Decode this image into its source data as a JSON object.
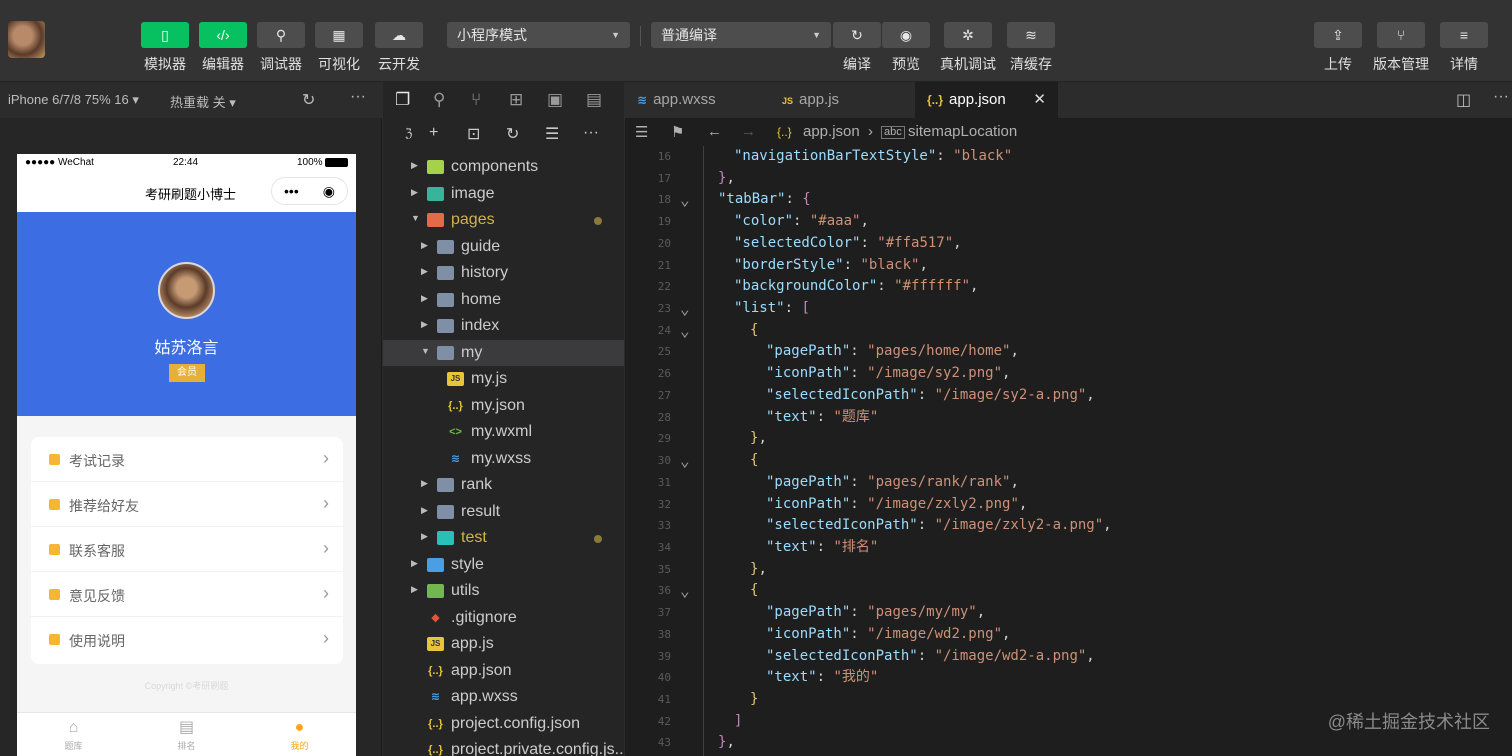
{
  "toolbar": {
    "left_buttons": [
      {
        "label": "模拟器",
        "icon": "phone-icon",
        "glyph": "▯",
        "green": true
      },
      {
        "label": "编辑器",
        "icon": "code-icon",
        "glyph": "‹/›",
        "green": true
      },
      {
        "label": "调试器",
        "icon": "debug-icon",
        "glyph": "⚲",
        "green": false
      },
      {
        "label": "可视化",
        "icon": "layout-icon",
        "glyph": "▦",
        "green": false
      },
      {
        "label": "云开发",
        "icon": "cloud-icon",
        "glyph": "☁",
        "green": false
      }
    ],
    "mode_select": "小程序模式",
    "compile_select": "普通编译",
    "mid_buttons": [
      {
        "label": "编译",
        "icon": "refresh-icon",
        "glyph": "↻"
      },
      {
        "label": "预览",
        "icon": "eye-icon",
        "glyph": "◉"
      },
      {
        "label": "真机调试",
        "icon": "bug-icon",
        "glyph": "✲"
      },
      {
        "label": "清缓存",
        "icon": "layers-icon",
        "glyph": "≋"
      }
    ],
    "right_buttons": [
      {
        "label": "上传",
        "icon": "upload-icon",
        "glyph": "⇪"
      },
      {
        "label": "版本管理",
        "icon": "branch-icon",
        "glyph": "⑂"
      },
      {
        "label": "详情",
        "icon": "menu-icon",
        "glyph": "≡"
      }
    ]
  },
  "simulator": {
    "device": "iPhone 6/7/8 75% 16 ▾",
    "reload": "热重载 关 ▾",
    "status_left": "●●●●● WeChat",
    "status_time": "22:44",
    "status_right": "100%",
    "nav_title": "考研刷题小博士",
    "user_name": "姑苏洛言",
    "member_badge": "会员",
    "menu": [
      "考试记录",
      "推荐给好友",
      "联系客服",
      "意见反馈",
      "使用说明"
    ],
    "faint_text": "Copyright ©考研刷题",
    "tabs": [
      {
        "label": "题库",
        "icon": "home-icon",
        "glyph": "⌂",
        "active": false
      },
      {
        "label": "排名",
        "icon": "list-icon",
        "glyph": "▤",
        "active": false
      },
      {
        "label": "我的",
        "icon": "user-icon",
        "glyph": "●",
        "active": true
      }
    ]
  },
  "explorer": {
    "items": [
      {
        "name": "components",
        "depth": 0,
        "type": "folder",
        "open": false,
        "color": "#a6d14a"
      },
      {
        "name": "image",
        "depth": 0,
        "type": "folder",
        "open": false,
        "color": "#39b39a"
      },
      {
        "name": "pages",
        "depth": 0,
        "type": "folder",
        "open": true,
        "color": "#e46b4a",
        "modified": true
      },
      {
        "name": "guide",
        "depth": 1,
        "type": "folder",
        "open": false,
        "color": "#7f8fa6"
      },
      {
        "name": "history",
        "depth": 1,
        "type": "folder",
        "open": false,
        "color": "#7f8fa6"
      },
      {
        "name": "home",
        "depth": 1,
        "type": "folder",
        "open": false,
        "color": "#7f8fa6"
      },
      {
        "name": "index",
        "depth": 1,
        "type": "folder",
        "open": false,
        "color": "#7f8fa6"
      },
      {
        "name": "my",
        "depth": 1,
        "type": "folder",
        "open": true,
        "color": "#7f8fa6",
        "selected": true
      },
      {
        "name": "my.js",
        "depth": 2,
        "type": "js"
      },
      {
        "name": "my.json",
        "depth": 2,
        "type": "json"
      },
      {
        "name": "my.wxml",
        "depth": 2,
        "type": "wxml"
      },
      {
        "name": "my.wxss",
        "depth": 2,
        "type": "wxss"
      },
      {
        "name": "rank",
        "depth": 1,
        "type": "folder",
        "open": false,
        "color": "#7f8fa6"
      },
      {
        "name": "result",
        "depth": 1,
        "type": "folder",
        "open": false,
        "color": "#7f8fa6"
      },
      {
        "name": "test",
        "depth": 1,
        "type": "folder",
        "open": false,
        "color": "#29c1b7",
        "modified": true,
        "yellow": true
      },
      {
        "name": "style",
        "depth": 0,
        "type": "folder",
        "open": false,
        "color": "#4a9ee4"
      },
      {
        "name": "utils",
        "depth": 0,
        "type": "folder",
        "open": false,
        "color": "#72b84e"
      },
      {
        "name": ".gitignore",
        "depth": 0,
        "type": "git"
      },
      {
        "name": "app.js",
        "depth": 0,
        "type": "js"
      },
      {
        "name": "app.json",
        "depth": 0,
        "type": "json"
      },
      {
        "name": "app.wxss",
        "depth": 0,
        "type": "wxss"
      },
      {
        "name": "project.config.json",
        "depth": 0,
        "type": "json"
      },
      {
        "name": "project.private.config.js...",
        "depth": 0,
        "type": "json"
      }
    ]
  },
  "editor": {
    "tabs": [
      {
        "label": "app.wxss",
        "icon": "css-icon",
        "glyph": "≋",
        "color": "#4a9ee4",
        "active": false
      },
      {
        "label": "app.js",
        "icon": "js-icon",
        "glyph": "JS",
        "color": "#e8c43a",
        "active": false
      },
      {
        "label": "app.json",
        "icon": "json-icon",
        "glyph": "{..}",
        "color": "#e8c43a",
        "active": true
      }
    ],
    "close_glyph": "✕",
    "breadcrumb": [
      "app.json",
      "sitemapLocation"
    ],
    "lines": [
      {
        "n": "16",
        "i": 1,
        "t": [
          [
            "k",
            "\"navigationBarTextStyle\""
          ],
          [
            "p",
            ": "
          ],
          [
            "s",
            "\"black\""
          ]
        ]
      },
      {
        "n": "17",
        "i": 0,
        "t": [
          [
            "b2",
            "}"
          ],
          [
            "p",
            ","
          ]
        ]
      },
      {
        "n": "18",
        "i": 0,
        "fold": true,
        "t": [
          [
            "k",
            "\"tabBar\""
          ],
          [
            "p",
            ": "
          ],
          [
            "b2",
            "{"
          ]
        ]
      },
      {
        "n": "19",
        "i": 1,
        "t": [
          [
            "k",
            "\"color\""
          ],
          [
            "p",
            ": "
          ],
          [
            "s",
            "\"#aaa\""
          ],
          [
            "p",
            ","
          ]
        ]
      },
      {
        "n": "20",
        "i": 1,
        "t": [
          [
            "k",
            "\"selectedColor\""
          ],
          [
            "p",
            ": "
          ],
          [
            "s",
            "\"#ffa517\""
          ],
          [
            "p",
            ","
          ]
        ]
      },
      {
        "n": "21",
        "i": 1,
        "t": [
          [
            "k",
            "\"borderStyle\""
          ],
          [
            "p",
            ": "
          ],
          [
            "s",
            "\"black\""
          ],
          [
            "p",
            ","
          ]
        ]
      },
      {
        "n": "22",
        "i": 1,
        "t": [
          [
            "k",
            "\"backgroundColor\""
          ],
          [
            "p",
            ": "
          ],
          [
            "s",
            "\"#ffffff\""
          ],
          [
            "p",
            ","
          ]
        ]
      },
      {
        "n": "23",
        "i": 1,
        "fold": true,
        "t": [
          [
            "k",
            "\"list\""
          ],
          [
            "p",
            ": "
          ],
          [
            "b2",
            "["
          ]
        ]
      },
      {
        "n": "24",
        "i": 2,
        "fold": true,
        "t": [
          [
            "b1",
            "{"
          ]
        ]
      },
      {
        "n": "25",
        "i": 3,
        "t": [
          [
            "k",
            "\"pagePath\""
          ],
          [
            "p",
            ": "
          ],
          [
            "s",
            "\"pages/home/home\""
          ],
          [
            "p",
            ","
          ]
        ]
      },
      {
        "n": "26",
        "i": 3,
        "t": [
          [
            "k",
            "\"iconPath\""
          ],
          [
            "p",
            ": "
          ],
          [
            "s",
            "\"/image/sy2.png\""
          ],
          [
            "p",
            ","
          ]
        ]
      },
      {
        "n": "27",
        "i": 3,
        "t": [
          [
            "k",
            "\"selectedIconPath\""
          ],
          [
            "p",
            ": "
          ],
          [
            "s",
            "\"/image/sy2-a.png\""
          ],
          [
            "p",
            ","
          ]
        ]
      },
      {
        "n": "28",
        "i": 3,
        "t": [
          [
            "k",
            "\"text\""
          ],
          [
            "p",
            ": "
          ],
          [
            "s",
            "\"题库\""
          ]
        ]
      },
      {
        "n": "29",
        "i": 2,
        "t": [
          [
            "b1",
            "}"
          ],
          [
            "p",
            ","
          ]
        ]
      },
      {
        "n": "30",
        "i": 2,
        "fold": true,
        "t": [
          [
            "b1",
            "{"
          ]
        ]
      },
      {
        "n": "31",
        "i": 3,
        "t": [
          [
            "k",
            "\"pagePath\""
          ],
          [
            "p",
            ": "
          ],
          [
            "s",
            "\"pages/rank/rank\""
          ],
          [
            "p",
            ","
          ]
        ]
      },
      {
        "n": "32",
        "i": 3,
        "t": [
          [
            "k",
            "\"iconPath\""
          ],
          [
            "p",
            ": "
          ],
          [
            "s",
            "\"/image/zxly2.png\""
          ],
          [
            "p",
            ","
          ]
        ]
      },
      {
        "n": "33",
        "i": 3,
        "t": [
          [
            "k",
            "\"selectedIconPath\""
          ],
          [
            "p",
            ": "
          ],
          [
            "s",
            "\"/image/zxly2-a.png\""
          ],
          [
            "p",
            ","
          ]
        ]
      },
      {
        "n": "34",
        "i": 3,
        "t": [
          [
            "k",
            "\"text\""
          ],
          [
            "p",
            ": "
          ],
          [
            "s",
            "\"排名\""
          ]
        ]
      },
      {
        "n": "35",
        "i": 2,
        "t": [
          [
            "b1",
            "}"
          ],
          [
            "p",
            ","
          ]
        ]
      },
      {
        "n": "36",
        "i": 2,
        "fold": true,
        "t": [
          [
            "b1",
            "{"
          ]
        ]
      },
      {
        "n": "37",
        "i": 3,
        "t": [
          [
            "k",
            "\"pagePath\""
          ],
          [
            "p",
            ": "
          ],
          [
            "s",
            "\"pages/my/my\""
          ],
          [
            "p",
            ","
          ]
        ]
      },
      {
        "n": "38",
        "i": 3,
        "t": [
          [
            "k",
            "\"iconPath\""
          ],
          [
            "p",
            ": "
          ],
          [
            "s",
            "\"/image/wd2.png\""
          ],
          [
            "p",
            ","
          ]
        ]
      },
      {
        "n": "39",
        "i": 3,
        "t": [
          [
            "k",
            "\"selectedIconPath\""
          ],
          [
            "p",
            ": "
          ],
          [
            "s",
            "\"/image/wd2-a.png\""
          ],
          [
            "p",
            ","
          ]
        ]
      },
      {
        "n": "40",
        "i": 3,
        "t": [
          [
            "k",
            "\"text\""
          ],
          [
            "p",
            ": "
          ],
          [
            "s",
            "\"我的\""
          ]
        ]
      },
      {
        "n": "41",
        "i": 2,
        "t": [
          [
            "b1",
            "}"
          ]
        ]
      },
      {
        "n": "42",
        "i": 1,
        "t": [
          [
            "b2",
            "]"
          ]
        ]
      },
      {
        "n": "43",
        "i": 0,
        "t": [
          [
            "b2",
            "}"
          ],
          [
            "p",
            ","
          ]
        ]
      }
    ]
  },
  "watermark": "@稀土掘金技术社区",
  "colors": {
    "accent_green": "#07c160",
    "brand_blue": "#3d6de2",
    "tab_active": "#ffa517"
  }
}
